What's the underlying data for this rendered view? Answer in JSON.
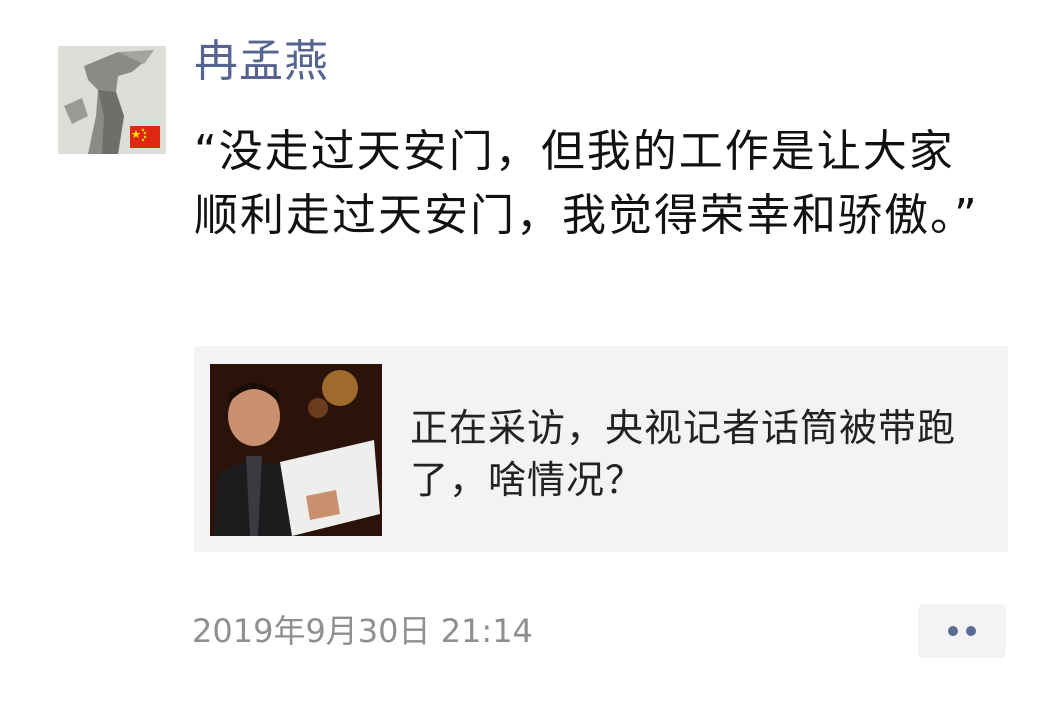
{
  "post": {
    "author": "冉孟燕",
    "text": "“没走过天安门，但我的工作是让大家顺利走过天安门，我觉得荣幸和骄傲。”",
    "timestamp": "2019年9月30日 21:14"
  },
  "link_card": {
    "title": "正在采访，央视记者话筒被带跑了，啥情况？"
  },
  "icons": {
    "avatar": "avatar-image",
    "flag": "china-flag-icon",
    "more": "more-options-icon"
  },
  "colors": {
    "author_name": "#56658f",
    "text": "#111111",
    "timestamp": "#8f8f8f",
    "card_background": "#f3f3f5",
    "more_dots": "#5a6b94",
    "flag_red": "#de2910",
    "flag_yellow": "#ffde00"
  }
}
